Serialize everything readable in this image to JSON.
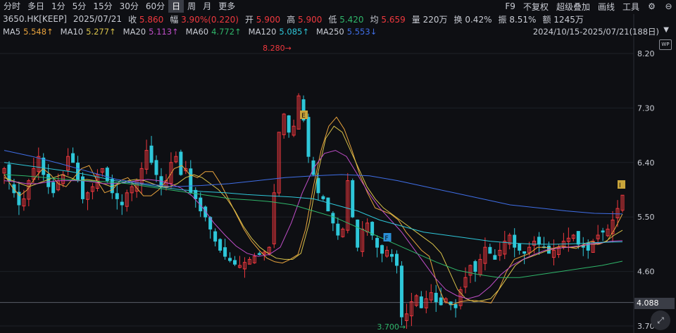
{
  "toolbar": {
    "tabs": [
      "分时",
      "多日",
      "1分",
      "5分",
      "15分",
      "30分",
      "60分",
      "日",
      "周",
      "月",
      "更多"
    ],
    "active_tab": "日",
    "right": {
      "f9": "F9",
      "adjust": "不复权",
      "overlay": "超级叠加",
      "draw": "画线",
      "tools": "工具"
    }
  },
  "quote": {
    "code": "3650.HK[KEEP]",
    "date": "2025/07/21",
    "close_label": "收",
    "close": "5.860",
    "change_label": "幅",
    "change": "3.90%(0.220)",
    "open_label": "开",
    "open": "5.900",
    "high_label": "高",
    "high": "5.900",
    "low_label": "低",
    "low": "5.420",
    "avg_label": "均",
    "avg": "5.659",
    "volume_label": "量",
    "volume": "220万",
    "turnover_label": "换",
    "turnover": "0.42%",
    "amplitude_label": "振",
    "amplitude": "8.51%",
    "amount_label": "额",
    "amount": "1245万"
  },
  "ma": [
    {
      "name": "MA5",
      "value": "5.548↑",
      "color": "#e8a33d"
    },
    {
      "name": "MA10",
      "value": "5.277↑",
      "color": "#d8c24a"
    },
    {
      "name": "MA20",
      "value": "5.113↑",
      "color": "#c04ec9"
    },
    {
      "name": "MA60",
      "value": "4.772↑",
      "color": "#2fb66a"
    },
    {
      "name": "MA120",
      "value": "5.085↑",
      "color": "#2ec7d9"
    },
    {
      "name": "MA250",
      "value": "5.553↓",
      "color": "#3f6ee6"
    }
  ],
  "range": "2024/10/15-2025/07/21(188日)",
  "badge_wp": "WP",
  "current_price_label": "4.088",
  "chart_data": {
    "type": "candlestick",
    "y_ticks": [
      "8.20",
      "7.30",
      "6.40",
      "5.50",
      "4.60",
      "3.70"
    ],
    "ylim": [
      3.7,
      8.2
    ],
    "max_label": "8.280",
    "min_label": "3.700",
    "markers": [
      "E",
      "F",
      "I"
    ],
    "up_color": "#f0383e",
    "down_color": "#2ec7d9",
    "closes": [
      6.3,
      6.1,
      5.9,
      5.7,
      5.8,
      6.1,
      6.3,
      6.5,
      6.2,
      6.0,
      5.9,
      6.1,
      6.2,
      6.5,
      6.4,
      6.1,
      5.8,
      5.9,
      6.0,
      6.2,
      6.3,
      6.1,
      5.9,
      5.8,
      5.7,
      5.9,
      6.0,
      6.1,
      6.3,
      6.6,
      6.4,
      6.2,
      6.0,
      6.1,
      6.4,
      6.5,
      6.2,
      6.3,
      5.9,
      5.8,
      5.6,
      5.5,
      5.3,
      5.1,
      4.95,
      4.85,
      4.78,
      4.72,
      4.7,
      4.75,
      4.8,
      4.85,
      4.88,
      4.92,
      5.0,
      5.9,
      6.9,
      7.2,
      6.9,
      7.0,
      7.5,
      7.1,
      6.5,
      6.2,
      5.9,
      5.8,
      5.6,
      5.4,
      5.2,
      5.3,
      6.1,
      5.5,
      5.0,
      5.3,
      5.4,
      5.2,
      5.0,
      4.9,
      4.95,
      4.85,
      4.7,
      3.85,
      3.9,
      4.1,
      4.2,
      4.0,
      4.15,
      4.25,
      4.1,
      4.05,
      4.15,
      4.05,
      4.0,
      4.3,
      4.5,
      4.7,
      4.6,
      4.8,
      5.0,
      4.9,
      4.8,
      4.95,
      5.1,
      5.2,
      5.0,
      4.95,
      4.9,
      5.0,
      5.1,
      5.05,
      5.0,
      4.9,
      4.95,
      5.0,
      5.1,
      5.15,
      5.2,
      5.05,
      5.0,
      4.95,
      5.1,
      5.2,
      5.25,
      5.3,
      5.45,
      5.64,
      5.86
    ],
    "series": [
      {
        "name": "MA5",
        "values": [
          6.2,
          6.0,
          5.85,
          5.95,
          6.15,
          6.3,
          6.2,
          6.05,
          6.0,
          6.15,
          6.3,
          6.35,
          6.1,
          5.9,
          5.95,
          6.1,
          6.15,
          6.0,
          5.85,
          5.85,
          5.95,
          6.1,
          6.3,
          6.35,
          6.2,
          6.15,
          6.25,
          6.25,
          6.05,
          5.8,
          5.55,
          5.3,
          5.1,
          4.95,
          4.82,
          4.76,
          4.74,
          4.8,
          4.88,
          5.3,
          6.0,
          6.6,
          7.0,
          7.15,
          6.95,
          6.6,
          6.2,
          5.9,
          5.65,
          5.6,
          5.55,
          5.45,
          5.25,
          5.1,
          4.95,
          4.85,
          4.4,
          4.1,
          4.05,
          4.1,
          4.12,
          4.12,
          4.1,
          4.08,
          4.3,
          4.6,
          4.8,
          4.85,
          4.9,
          5.0,
          5.0,
          4.98,
          5.02,
          5.0,
          4.98,
          5.05,
          5.1,
          5.05,
          5.1,
          5.3,
          5.55
        ]
      },
      {
        "name": "MA10",
        "values": [
          6.15,
          6.1,
          6.05,
          6.0,
          6.05,
          6.1,
          6.15,
          6.2,
          6.15,
          6.1,
          6.12,
          6.1,
          6.05,
          6.0,
          6.05,
          6.1,
          6.12,
          6.1,
          6.05,
          6.0,
          6.0,
          6.05,
          6.15,
          6.2,
          6.15,
          6.05,
          5.95,
          5.8,
          5.6,
          5.35,
          5.15,
          5.0,
          4.9,
          4.82,
          4.8,
          4.8,
          4.9,
          5.4,
          6.2,
          6.8,
          7.0,
          6.9,
          6.6,
          6.3,
          6.0,
          5.8,
          5.65,
          5.55,
          5.45,
          5.35,
          5.25,
          5.15,
          5.05,
          4.9,
          4.6,
          4.3,
          4.15,
          4.1,
          4.12,
          4.15,
          4.3,
          4.5,
          4.7,
          4.8,
          4.85,
          4.9,
          4.95,
          4.98,
          5.0,
          5.0,
          5.02,
          5.05,
          5.05,
          5.1,
          5.2,
          5.28
        ]
      },
      {
        "name": "MA20",
        "values": [
          6.1,
          6.08,
          6.05,
          6.05,
          6.08,
          6.1,
          6.1,
          6.1,
          6.08,
          6.05,
          6.05,
          6.07,
          6.1,
          6.12,
          6.1,
          6.05,
          5.98,
          5.85,
          5.65,
          5.4,
          5.2,
          5.02,
          4.9,
          4.85,
          4.88,
          5.0,
          5.4,
          5.9,
          6.3,
          6.55,
          6.6,
          6.5,
          6.2,
          5.9,
          5.65,
          5.45,
          5.25,
          5.0,
          4.75,
          4.5,
          4.3,
          4.2,
          4.15,
          4.2,
          4.35,
          4.55,
          4.7,
          4.8,
          4.88,
          4.95,
          4.98,
          5.0,
          5.02,
          5.05,
          5.07,
          5.1,
          5.11
        ]
      },
      {
        "name": "MA60",
        "values": [
          6.2,
          6.18,
          6.15,
          6.12,
          6.1,
          6.08,
          6.05,
          6.0,
          5.95,
          5.9,
          5.85,
          5.8,
          5.78,
          5.75,
          5.7,
          5.6,
          5.5,
          5.35,
          5.2,
          5.05,
          4.9,
          4.75,
          4.62,
          4.55,
          4.5,
          4.5,
          4.55,
          4.6,
          4.65,
          4.7,
          4.77
        ]
      },
      {
        "name": "MA120",
        "values": [
          6.4,
          6.35,
          6.3,
          6.25,
          6.18,
          6.1,
          6.05,
          6.0,
          5.95,
          5.92,
          5.9,
          5.87,
          5.85,
          5.83,
          5.8,
          5.7,
          5.6,
          5.45,
          5.35,
          5.25,
          5.2,
          5.15,
          5.1,
          5.07,
          5.05,
          5.05,
          5.06,
          5.08,
          5.09
        ]
      },
      {
        "name": "MA250",
        "values": [
          6.6,
          6.5,
          6.38,
          6.25,
          6.12,
          6.05,
          6.0,
          6.02,
          6.05,
          6.1,
          6.15,
          6.18,
          6.2,
          6.18,
          6.1,
          6.0,
          5.9,
          5.8,
          5.7,
          5.65,
          5.6,
          5.56,
          5.55
        ]
      }
    ]
  }
}
